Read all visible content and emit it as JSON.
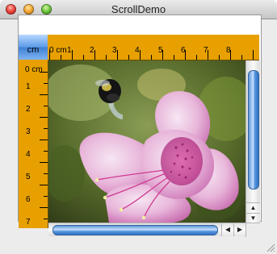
{
  "window": {
    "title": "ScrollDemo"
  },
  "corner_unit": "cm",
  "hruler": {
    "labels": [
      "0 cm",
      "1",
      "2",
      "3",
      "4",
      "5",
      "6",
      "7",
      "8"
    ]
  },
  "vruler": {
    "labels": [
      "0 cm",
      "1",
      "2",
      "3",
      "4",
      "5",
      "6",
      "7"
    ]
  },
  "image": {
    "subject": "pink-azalea-flower-with-bumblebee"
  },
  "colors": {
    "ruler": "#e7a000",
    "scroll_thumb": "#5d9be3",
    "flower_pink": "#e58fc8"
  }
}
